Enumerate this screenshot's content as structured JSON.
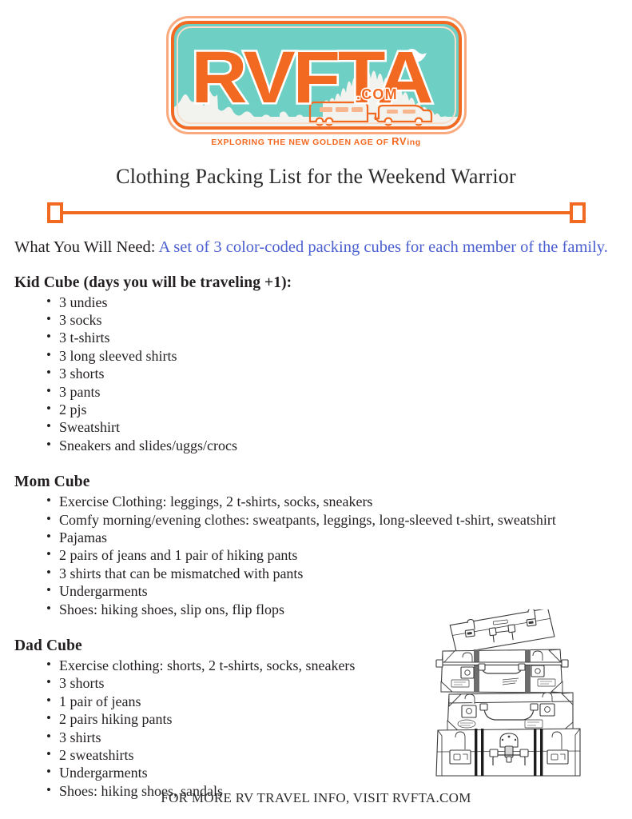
{
  "logo": {
    "brand": "RVFTA",
    "domain_suffix": ".COM",
    "tagline_main": "EXPLORING THE NEW GOLDEN AGE OF ",
    "tagline_rv": "RV",
    "tagline_end": "ing",
    "plate_bg_color": "#6ecfc4",
    "plate_border_color": "#f26a21",
    "scenery_color": "#f2f3ee"
  },
  "title": "Clothing Packing List for the Weekend Warrior",
  "divider": {
    "color": "#f26a21"
  },
  "need": {
    "label": "What You Will Need: ",
    "value": "A set of 3 color-coded packing cubes for each member of the family.",
    "value_color": "#4a5fd0"
  },
  "sections": [
    {
      "heading": "Kid Cube (days you will be traveling +1):",
      "items": [
        "3 undies",
        "3 socks",
        "3 t-shirts",
        "3 long sleeved shirts",
        "3 shorts",
        "3 pants",
        "2 pjs",
        "Sweatshirt",
        "Sneakers and slides/uggs/crocs"
      ]
    },
    {
      "heading": "Mom Cube",
      "items": [
        "Exercise Clothing: leggings, 2 t-shirts, socks, sneakers",
        "Comfy morning/evening clothes: sweatpants, leggings, long-sleeved t-shirt, sweatshirt",
        "Pajamas",
        "2 pairs of jeans and 1 pair of hiking pants",
        "3 shirts that can be mismatched with pants",
        "Undergarments",
        "Shoes: hiking shoes, slip ons, flip flops"
      ]
    },
    {
      "heading": "Dad Cube",
      "items": [
        "Exercise clothing: shorts, 2 t-shirts, socks, sneakers",
        "3 shorts",
        "1 pair of jeans",
        "2 pairs hiking pants",
        "3 shirts",
        "2 sweatshirts",
        "Undergarments",
        "Shoes: hiking shoes, sandals"
      ]
    }
  ],
  "illustration": {
    "name": "stacked-suitcases-illustration"
  },
  "footer": "FOR MORE RV TRAVEL INFO, VISIT RVFTA.COM"
}
